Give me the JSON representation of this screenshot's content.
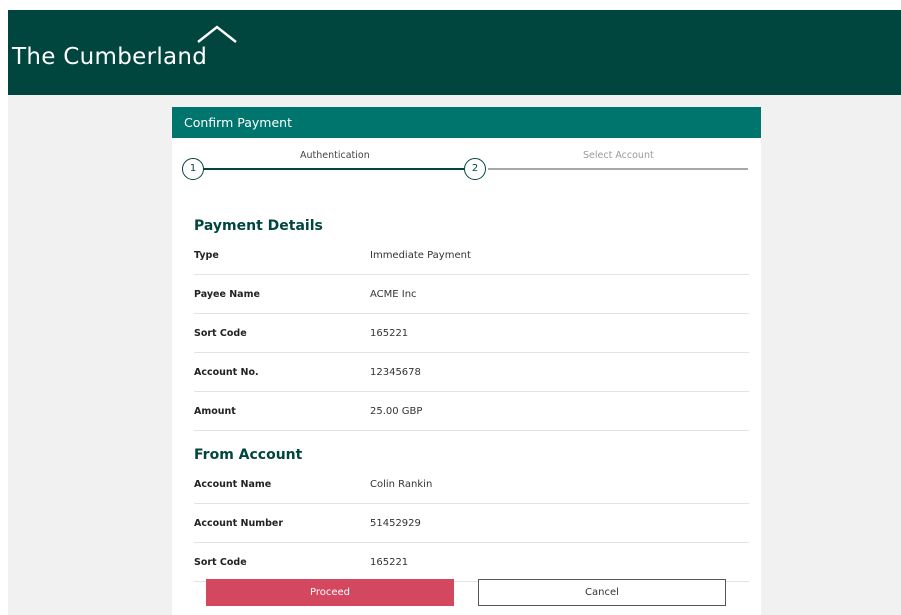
{
  "brand": {
    "name": "The Cumberland",
    "header_color": "#00463f"
  },
  "card": {
    "title": "Confirm Payment",
    "header_color": "#00756d"
  },
  "stepper": {
    "steps": [
      {
        "number": "1",
        "label": "Authentication",
        "state": "complete"
      },
      {
        "number": "2",
        "label": "Select Account",
        "state": "current"
      }
    ]
  },
  "payment_details": {
    "title": "Payment Details",
    "rows": [
      {
        "label": "Type",
        "value": "Immediate Payment"
      },
      {
        "label": "Payee Name",
        "value": "ACME Inc"
      },
      {
        "label": "Sort Code",
        "value": "165221"
      },
      {
        "label": "Account No.",
        "value": "12345678"
      },
      {
        "label": "Amount",
        "value": "25.00 GBP"
      }
    ]
  },
  "from_account": {
    "title": "From Account",
    "rows": [
      {
        "label": "Account Name",
        "value": "Colin Rankin"
      },
      {
        "label": "Account Number",
        "value": "51452929"
      },
      {
        "label": "Sort Code",
        "value": "165221"
      }
    ]
  },
  "actions": {
    "proceed_label": "Proceed",
    "cancel_label": "Cancel",
    "proceed_color": "#d4485f"
  }
}
